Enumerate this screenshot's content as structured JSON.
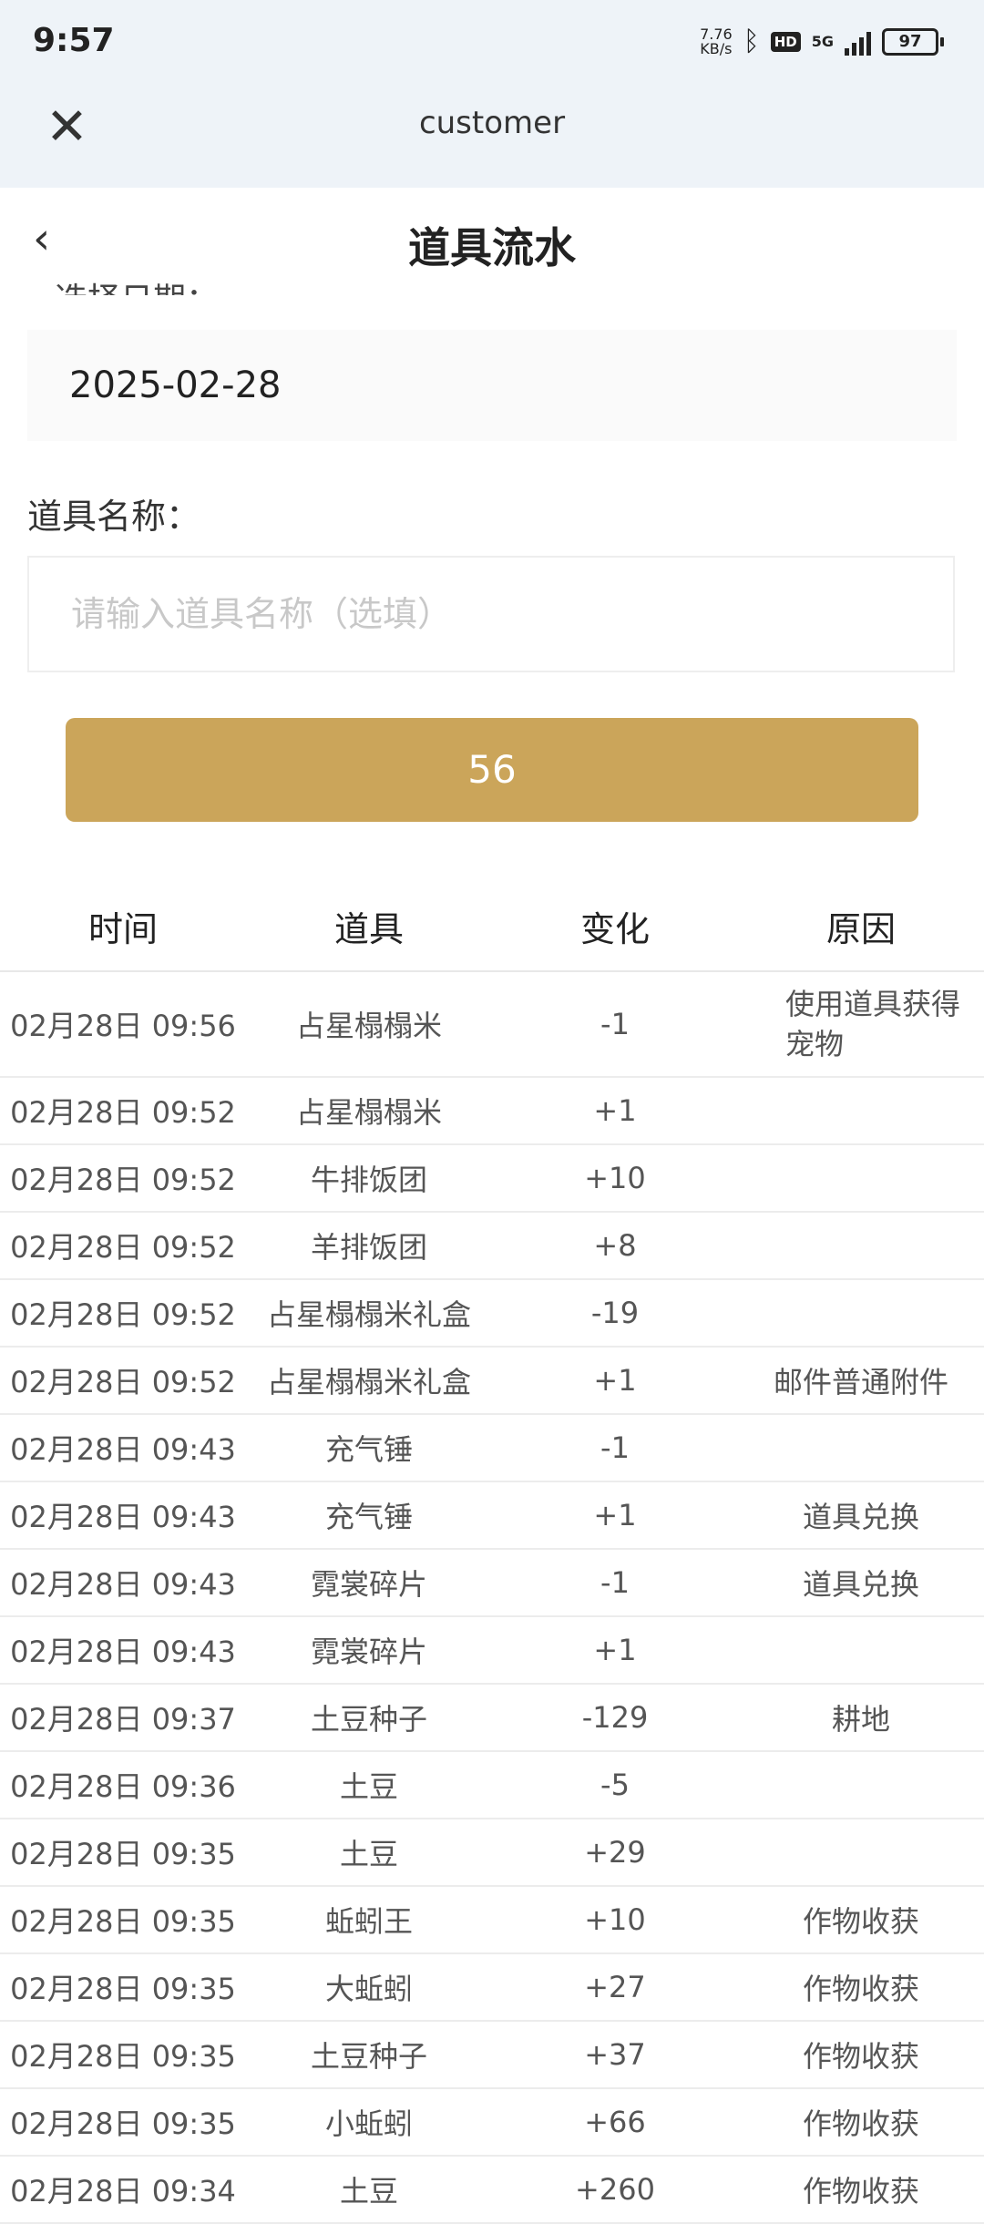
{
  "status": {
    "time": "9:57",
    "speed_top": "7.76",
    "speed_bottom": "KB/s",
    "network": "5G",
    "battery": "97"
  },
  "webview": {
    "title": "customer"
  },
  "nav": {
    "title": "道具流水"
  },
  "form": {
    "date_label_cutoff": "选择日期：",
    "date_value": "2025-02-28",
    "name_label": "道具名称：",
    "name_placeholder": "请输入道具名称（选填）",
    "query_button": "56"
  },
  "table": {
    "headers": [
      "时间",
      "道具",
      "变化",
      "原因"
    ],
    "rows": [
      {
        "time": "02月28日 09:56",
        "item": "占星榻榻米",
        "change": "-1",
        "reason": "使用道具获得宠物"
      },
      {
        "time": "02月28日 09:52",
        "item": "占星榻榻米",
        "change": "+1",
        "reason": ""
      },
      {
        "time": "02月28日 09:52",
        "item": "牛排饭团",
        "change": "+10",
        "reason": ""
      },
      {
        "time": "02月28日 09:52",
        "item": "羊排饭团",
        "change": "+8",
        "reason": ""
      },
      {
        "time": "02月28日 09:52",
        "item": "占星榻榻米礼盒",
        "change": "-19",
        "reason": ""
      },
      {
        "time": "02月28日 09:52",
        "item": "占星榻榻米礼盒",
        "change": "+1",
        "reason": "邮件普通附件"
      },
      {
        "time": "02月28日 09:43",
        "item": "充气锤",
        "change": "-1",
        "reason": ""
      },
      {
        "time": "02月28日 09:43",
        "item": "充气锤",
        "change": "+1",
        "reason": "道具兑换"
      },
      {
        "time": "02月28日 09:43",
        "item": "霓裳碎片",
        "change": "-1",
        "reason": "道具兑换"
      },
      {
        "time": "02月28日 09:43",
        "item": "霓裳碎片",
        "change": "+1",
        "reason": ""
      },
      {
        "time": "02月28日 09:37",
        "item": "土豆种子",
        "change": "-129",
        "reason": "耕地"
      },
      {
        "time": "02月28日 09:36",
        "item": "土豆",
        "change": "-5",
        "reason": ""
      },
      {
        "time": "02月28日 09:35",
        "item": "土豆",
        "change": "+29",
        "reason": ""
      },
      {
        "time": "02月28日 09:35",
        "item": "蚯蚓王",
        "change": "+10",
        "reason": "作物收获"
      },
      {
        "time": "02月28日 09:35",
        "item": "大蚯蚓",
        "change": "+27",
        "reason": "作物收获"
      },
      {
        "time": "02月28日 09:35",
        "item": "土豆种子",
        "change": "+37",
        "reason": "作物收获"
      },
      {
        "time": "02月28日 09:35",
        "item": "小蚯蚓",
        "change": "+66",
        "reason": "作物收获"
      },
      {
        "time": "02月28日 09:34",
        "item": "土豆",
        "change": "+260",
        "reason": "作物收获"
      }
    ]
  },
  "colors": {
    "accent": "#cba55a",
    "topbar": "#eef3f8"
  }
}
